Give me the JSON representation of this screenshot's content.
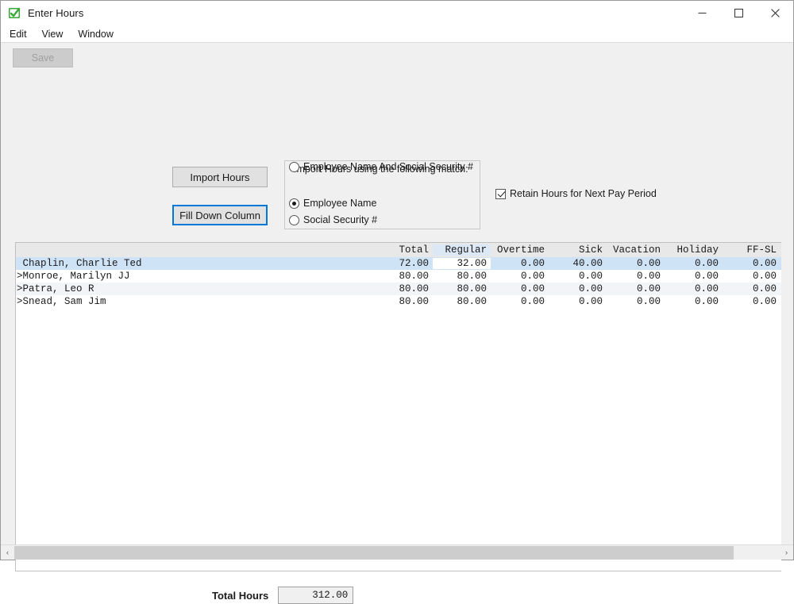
{
  "window": {
    "title": "Enter Hours",
    "icon": "app-checkmark-icon",
    "minimize_label": "—",
    "maximize_label": "☐",
    "close_label": "✕"
  },
  "menu": {
    "items": [
      {
        "label": "Edit"
      },
      {
        "label": "View"
      },
      {
        "label": "Window"
      }
    ]
  },
  "toolbar": {
    "save_label": "Save",
    "save_enabled": "false"
  },
  "actions": {
    "import_hours_label": "Import Hours",
    "fill_down_column_label": "Fill Down Column"
  },
  "import_group": {
    "title": "Import Hours using the following match:",
    "options": [
      {
        "label": "Employee Name",
        "selected": true
      },
      {
        "label": "Social Security #",
        "selected": false
      },
      {
        "label": "Employee Name And Social Security #",
        "selected": false
      }
    ]
  },
  "retain_checkbox": {
    "label": "Retain Hours for Next Pay Period",
    "checked": true
  },
  "grid": {
    "name_header": "",
    "columns": [
      "Total",
      "Regular",
      "Overtime",
      "Sick",
      "Vacation",
      "Holiday",
      "FF-SL"
    ],
    "active_column": "Regular",
    "rows": [
      {
        "name": " Chaplin, Charlie Ted",
        "values": [
          "72.00",
          "32.00",
          "0.00",
          "40.00",
          "0.00",
          "0.00",
          "0.00"
        ],
        "selected": true,
        "active_cell_index": 1
      },
      {
        "name": ">Monroe, Marilyn JJ",
        "values": [
          "80.00",
          "80.00",
          "0.00",
          "0.00",
          "0.00",
          "0.00",
          "0.00"
        ],
        "selected": false,
        "active_cell_index": -1
      },
      {
        "name": ">Patra, Leo R",
        "values": [
          "80.00",
          "80.00",
          "0.00",
          "0.00",
          "0.00",
          "0.00",
          "0.00"
        ],
        "selected": false,
        "active_cell_index": -1
      },
      {
        "name": ">Snead, Sam Jim",
        "values": [
          "80.00",
          "80.00",
          "0.00",
          "0.00",
          "0.00",
          "0.00",
          "0.00"
        ],
        "selected": false,
        "active_cell_index": -1
      }
    ]
  },
  "footer": {
    "total_hours_label": "Total Hours",
    "total_hours_value": "312.00"
  },
  "scrollbar": {
    "left_arrow": "‹",
    "right_arrow": "›"
  },
  "colors": {
    "selection": "#cfe3f7",
    "accent": "#0078d7",
    "panel": "#f0f0f0",
    "grid_header": "#e8e8e8",
    "alt_row": "#f2f4f7",
    "app_icon_green": "#3aa93a"
  }
}
